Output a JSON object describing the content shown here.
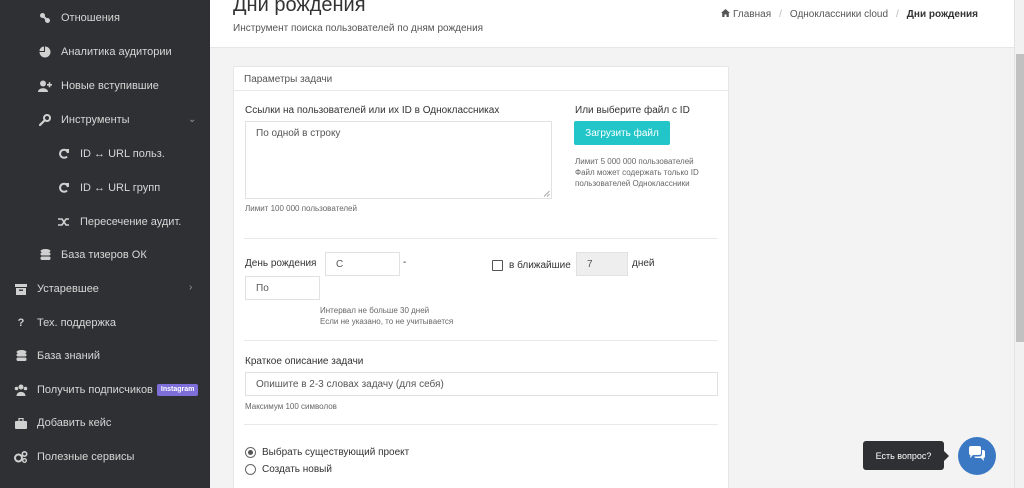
{
  "sidebar": {
    "items": [
      {
        "label": "Отношения",
        "icon": "link-icon"
      },
      {
        "label": "Аналитика аудитории",
        "icon": "pie-chart-icon"
      },
      {
        "label": "Новые вступившие",
        "icon": "user-plus-icon"
      },
      {
        "label": "Инструменты",
        "icon": "wrench-icon"
      },
      {
        "label": "ID ↔ URL польз.",
        "icon": "refresh-icon"
      },
      {
        "label": "ID ↔ URL групп",
        "icon": "refresh-icon"
      },
      {
        "label": "Пересечение аудит.",
        "icon": "shuffle-icon"
      },
      {
        "label": "База тизеров ОК",
        "icon": "database-icon"
      },
      {
        "label": "Устаревшее",
        "icon": "archive-icon"
      },
      {
        "label": "Тех. поддержка",
        "icon": "question-icon"
      },
      {
        "label": "База знаний",
        "icon": "database-icon"
      },
      {
        "label": "Получить подписчиков",
        "icon": "users-icon",
        "badge": "Instagram"
      },
      {
        "label": "Добавить кейс",
        "icon": "briefcase-icon"
      },
      {
        "label": "Полезные сервисы",
        "icon": "cogs-icon"
      }
    ]
  },
  "header": {
    "title": "Дни рождения",
    "subtitle": "Инструмент поиска пользователей по дням рождения",
    "breadcrumb": {
      "home": "Главная",
      "section": "Одноклассники cloud",
      "current": "Дни рождения"
    }
  },
  "panel": {
    "title": "Параметры задачи",
    "links_label": "Ссылки на пользователей или их ID в Одноклассниках",
    "links_placeholder": "По одной в строку",
    "links_limit": "Лимит 100 000 пользователей",
    "file_label": "Или выберите файл с ID",
    "upload_button": "Загрузить файл",
    "file_hint_1": "Лимит 5 000 000 пользователей",
    "file_hint_2": "Файл может содержать только ID",
    "file_hint_3": "пользователей Одноклассники",
    "birthday_label": "День рождения",
    "from_placeholder": "С",
    "dash": "-",
    "to_placeholder": "По",
    "interval_hint_1": "Интервал не больше 30 дней",
    "interval_hint_2": "Если не указано, то не учитывается",
    "nearest_label": "в ближайшие",
    "nearest_value": "7",
    "days_label": "дней",
    "desc_label": "Краткое описание задачи",
    "desc_placeholder": "Опишите в 2-3 словах задачу (для себя)",
    "desc_hint": "Максимум 100 символов",
    "radio_existing": "Выбрать существующий проект",
    "radio_new": "Создать новый"
  },
  "chat": {
    "label": "Есть вопрос?"
  },
  "colors": {
    "sidebar_bg": "#2f3033",
    "upload_btn": "#23c6c8",
    "chat_btn": "#3b78c4",
    "badge": "#7d6ed9"
  }
}
